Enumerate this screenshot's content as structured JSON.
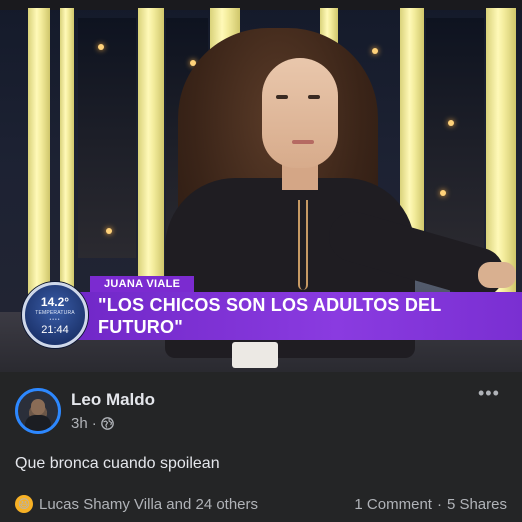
{
  "video": {
    "chyron_name": "JUANA VIALE",
    "chyron_headline": "\"LOS CHICOS SON LOS ADULTOS DEL FUTURO\"",
    "weather": {
      "temperature": "14.2°",
      "temperature_label": "TEMPERATURA",
      "time": "21:44"
    }
  },
  "post": {
    "author": "Leo Maldo",
    "time_ago": "3h",
    "separator": "·",
    "text": "Que bronca cuando spoilean",
    "reactors": "Lucas Shamy Villa and 24 others",
    "comments": "1 Comment",
    "stats_separator": "·",
    "shares": "5 Shares",
    "reaction_icon": "haha-emoji-icon",
    "privacy_icon": "globe-icon"
  },
  "colors": {
    "background": "#18191a",
    "card": "#242526",
    "chyron_purple": "#7b2bd0",
    "avatar_ring": "#2d88ff",
    "secondary_text": "#b0b3b8"
  }
}
